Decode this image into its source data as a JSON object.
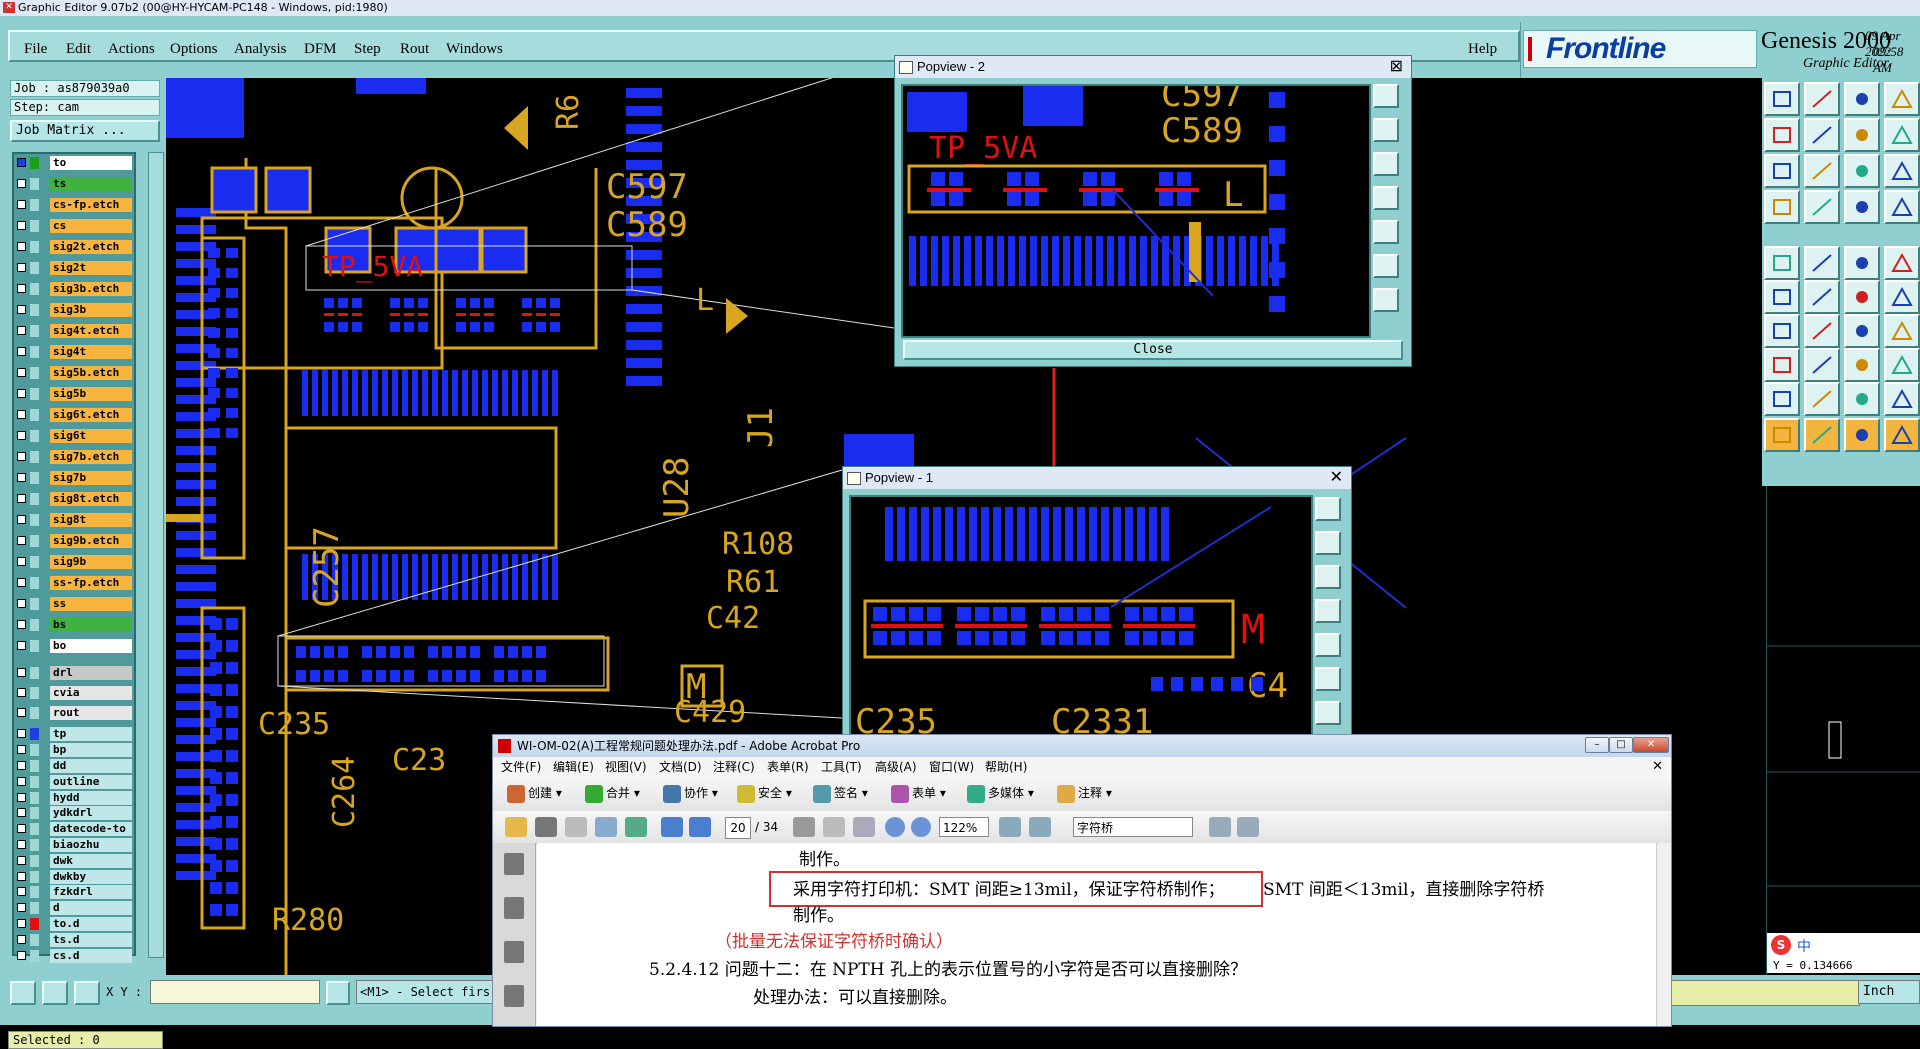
{
  "titlebar": {
    "text": "Graphic Editor 9.07b2 (00@HY-HYCAM-PC148 - Windows, pid:1980)"
  },
  "menu": {
    "items": [
      "File",
      "Edit",
      "Actions",
      "Options",
      "Analysis",
      "DFM",
      "Step",
      "Rout",
      "Windows"
    ],
    "help": "Help"
  },
  "brand": {
    "logo": "Frontline",
    "product": "Genesis 2000",
    "subtitle": "Graphic Editor",
    "date": "09 Apr 2022",
    "time": "09:58 AM"
  },
  "job": {
    "job": "Job : as879039a0",
    "step": "Step: cam",
    "matrix_button": "Job Matrix ..."
  },
  "layers": [
    {
      "name": "to",
      "color": "#ffffff",
      "swatch": "#1a9f1a",
      "sel": true
    },
    {
      "name": "ts",
      "color": "#3fb23f",
      "swatch": "#9fd6d6"
    },
    {
      "name": "cs-fp.etch",
      "color": "#f7b43f",
      "swatch": "#9fd6d6"
    },
    {
      "name": "cs",
      "color": "#f7b43f",
      "swatch": "#9fd6d6"
    },
    {
      "name": "sig2t.etch",
      "color": "#f7b43f",
      "swatch": "#9fd6d6"
    },
    {
      "name": "sig2t",
      "color": "#f7b43f",
      "swatch": "#9fd6d6"
    },
    {
      "name": "sig3b.etch",
      "color": "#f7b43f",
      "swatch": "#9fd6d6"
    },
    {
      "name": "sig3b",
      "color": "#f7b43f",
      "swatch": "#9fd6d6"
    },
    {
      "name": "sig4t.etch",
      "color": "#f7b43f",
      "swatch": "#9fd6d6"
    },
    {
      "name": "sig4t",
      "color": "#f7b43f",
      "swatch": "#9fd6d6"
    },
    {
      "name": "sig5b.etch",
      "color": "#f7b43f",
      "swatch": "#9fd6d6"
    },
    {
      "name": "sig5b",
      "color": "#f7b43f",
      "swatch": "#9fd6d6"
    },
    {
      "name": "sig6t.etch",
      "color": "#f7b43f",
      "swatch": "#9fd6d6"
    },
    {
      "name": "sig6t",
      "color": "#f7b43f",
      "swatch": "#9fd6d6"
    },
    {
      "name": "sig7b.etch",
      "color": "#f7b43f",
      "swatch": "#9fd6d6"
    },
    {
      "name": "sig7b",
      "color": "#f7b43f",
      "swatch": "#9fd6d6"
    },
    {
      "name": "sig8t.etch",
      "color": "#f7b43f",
      "swatch": "#9fd6d6"
    },
    {
      "name": "sig8t",
      "color": "#f7b43f",
      "swatch": "#9fd6d6"
    },
    {
      "name": "sig9b.etch",
      "color": "#f7b43f",
      "swatch": "#9fd6d6"
    },
    {
      "name": "sig9b",
      "color": "#f7b43f",
      "swatch": "#9fd6d6"
    },
    {
      "name": "ss-fp.etch",
      "color": "#f7b43f",
      "swatch": "#9fd6d6"
    },
    {
      "name": "ss",
      "color": "#f7b43f",
      "swatch": "#9fd6d6"
    },
    {
      "name": "bs",
      "color": "#3fb23f",
      "swatch": "#9fd6d6"
    },
    {
      "name": "bo",
      "color": "#ffffff",
      "swatch": "#9fd6d6"
    },
    {
      "name": "drl",
      "color": "#c8c8c8",
      "swatch": "#9fd6d6"
    },
    {
      "name": "cvia",
      "color": "#e6e6e6",
      "swatch": "#9fd6d6"
    },
    {
      "name": "rout",
      "color": "#e6e6e6",
      "swatch": "#9fd6d6"
    },
    {
      "name": "tp",
      "color": "#bfe7e7",
      "swatch": "#1f3fe0"
    },
    {
      "name": "bp",
      "color": "#bfe7e7",
      "swatch": "#9fd6d6"
    },
    {
      "name": "dd",
      "color": "#bfe7e7",
      "swatch": "#9fd6d6"
    },
    {
      "name": "outline",
      "color": "#bfe7e7",
      "swatch": "#9fd6d6"
    },
    {
      "name": "hydd",
      "color": "#bfe7e7",
      "swatch": "#9fd6d6"
    },
    {
      "name": "ydkdrl",
      "color": "#bfe7e7",
      "swatch": "#9fd6d6"
    },
    {
      "name": "datecode-to",
      "color": "#bfe7e7",
      "swatch": "#9fd6d6"
    },
    {
      "name": "biaozhu",
      "color": "#bfe7e7",
      "swatch": "#9fd6d6"
    },
    {
      "name": "dwk",
      "color": "#bfe7e7",
      "swatch": "#9fd6d6"
    },
    {
      "name": "dwkby",
      "color": "#bfe7e7",
      "swatch": "#9fd6d6"
    },
    {
      "name": "fzkdrl",
      "color": "#bfe7e7",
      "swatch": "#9fd6d6"
    },
    {
      "name": "d",
      "color": "#bfe7e7",
      "swatch": "#9fd6d6"
    },
    {
      "name": "to.d",
      "color": "#bfe7e7",
      "swatch": "#e01010"
    },
    {
      "name": "ts.d",
      "color": "#bfe7e7",
      "swatch": "#9fd6d6"
    },
    {
      "name": "cs.d",
      "color": "#bfe7e7",
      "swatch": "#9fd6d6"
    }
  ],
  "status": {
    "selected": "Selected : 0",
    "xy_label": "X Y :",
    "prompt": "<M1> - Select firs",
    "units": "Inch"
  },
  "popview2": {
    "title": "Popview - 2",
    "close": "Close"
  },
  "popview1": {
    "title": "Popview - 1"
  },
  "acrobat": {
    "title": "WI-OM-02(A)工程常规问题处理办法.pdf - Adobe Acrobat Pro",
    "menu": [
      "文件(F)",
      "编辑(E)",
      "视图(V)",
      "文档(D)",
      "注释(C)",
      "表单(R)",
      "工具(T)",
      "高级(A)",
      "窗口(W)",
      "帮助(H)"
    ],
    "toolbar1": [
      "创建",
      "合并",
      "协作",
      "安全",
      "签名",
      "表单",
      "多媒体",
      "注释"
    ],
    "page_current": "20",
    "page_total": "/ 34",
    "zoom": "122%",
    "search": "字符桥",
    "doc_lines": [
      "制作。",
      "采用字符打印机：SMT 间距≥13mil，保证字符桥制作；",
      "SMT 间距＜13mil，直接删除字符桥",
      "制作。",
      "（批量无法保证字符桥时确认）",
      "5.2.4.12  问题十二：在 NPTH 孔上的表示位置号的小字符是否可以直接删除？",
      "处理办法：可以直接删除。"
    ]
  },
  "board_labels": [
    "C597",
    "C589",
    "TP_5VA",
    "R6",
    "U28",
    "J1",
    "C257",
    "C235",
    "C23",
    "C264",
    "R280",
    "R108",
    "R61",
    "C42",
    "C429",
    "C235",
    "C2331",
    "C4",
    "M",
    "L",
    "TP_5VA",
    "C597",
    "C589"
  ],
  "ime": {
    "text": "中"
  },
  "overview": {
    "coord": "Y = 0.134666"
  },
  "colors": {
    "ui_teal": "#8fcfcf",
    "copper": "#d8a520",
    "pad_blue": "#1a2cf0",
    "marker_red": "#e01010"
  }
}
